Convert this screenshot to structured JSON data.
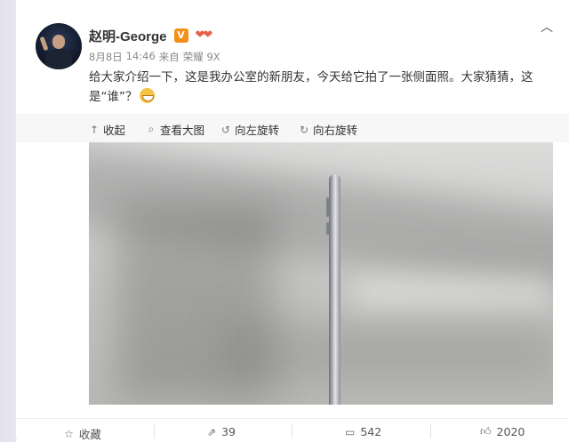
{
  "post": {
    "user_name": "赵明-George",
    "verified_mark": "V",
    "meta": {
      "date": "8月8日",
      "time": "14:46",
      "source_prefix": "来自",
      "source": "荣耀 9X"
    },
    "content": "给大家介绍一下，这是我办公室的新朋友，今天给它拍了一张侧面照。大家猜猜，这是“谁”？"
  },
  "toolbar": {
    "collapse": "收起",
    "view_large": "查看大图",
    "rotate_left": "向左旋转",
    "rotate_right": "向右旋转"
  },
  "footer": {
    "favorite": "收藏",
    "repost_count": "39",
    "comment_count": "542",
    "like_count": "2020"
  },
  "icons": {
    "more": "chevron-down-icon",
    "collapse": "arrow-up-icon",
    "view_large": "magnify-icon",
    "rotate_left": "rotate-left-icon",
    "rotate_right": "rotate-right-icon",
    "favorite": "star-icon",
    "repost": "repost-icon",
    "comment": "comment-icon",
    "like": "thumb-up-icon"
  },
  "colors": {
    "verified": "#f39018",
    "link": "#eb7350",
    "toolbar_bg": "#f7f7f7"
  }
}
